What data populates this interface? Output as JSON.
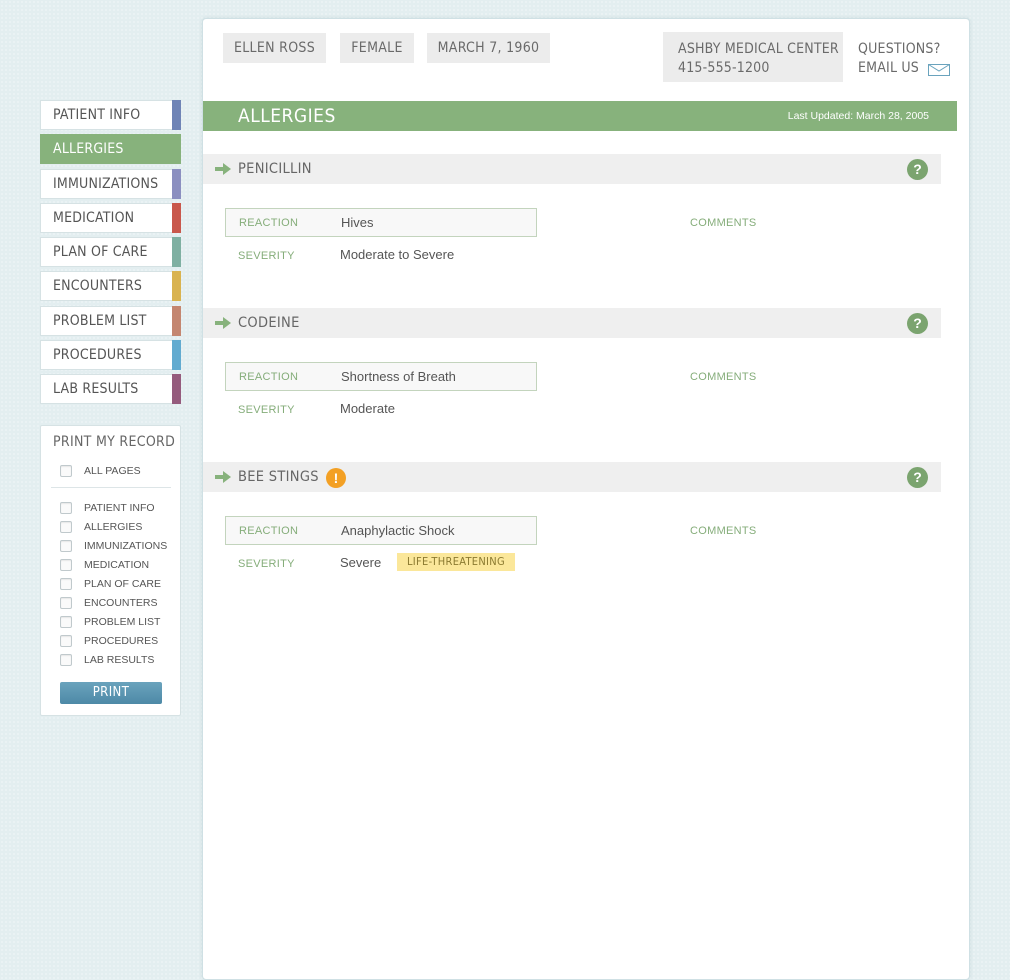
{
  "patient": {
    "name": "ELLEN ROSS",
    "gender": "FEMALE",
    "dob": "MARCH 7, 1960"
  },
  "facility": {
    "name": "ASHBY MEDICAL CENTER",
    "phone": "415-555-1200"
  },
  "contact": {
    "questions": "QUESTIONS?",
    "email_label": "EMAIL US",
    "email_icon": "envelope-icon"
  },
  "nav": {
    "items": [
      {
        "label": "PATIENT INFO",
        "color": "#6f84b6",
        "active": false
      },
      {
        "label": "ALLERGIES",
        "color": "#87b27c",
        "active": true
      },
      {
        "label": "IMMUNIZATIONS",
        "color": "#8b8fc0",
        "active": false
      },
      {
        "label": "MEDICATION",
        "color": "#c9584c",
        "active": false
      },
      {
        "label": "PLAN OF CARE",
        "color": "#7fb0a2",
        "active": false
      },
      {
        "label": "ENCOUNTERS",
        "color": "#d9b350",
        "active": false
      },
      {
        "label": "PROBLEM LIST",
        "color": "#c48670",
        "active": false
      },
      {
        "label": "PROCEDURES",
        "color": "#62abd0",
        "active": false
      },
      {
        "label": "LAB RESULTS",
        "color": "#955b7d",
        "active": false
      }
    ]
  },
  "print": {
    "title": "PRINT MY RECORD",
    "all_pages": "ALL PAGES",
    "options": [
      "PATIENT INFO",
      "ALLERGIES",
      "IMMUNIZATIONS",
      "MEDICATION",
      "PLAN OF CARE",
      "ENCOUNTERS",
      "PROBLEM LIST",
      "PROCEDURES",
      "LAB RESULTS"
    ],
    "button": "PRINT"
  },
  "section": {
    "title": "ALLERGIES",
    "last_updated": "Last Updated: March 28, 2005",
    "accent_color": "#87b27c"
  },
  "labels": {
    "reaction": "REACTION",
    "severity": "SEVERITY",
    "comments": "COMMENTS"
  },
  "allergies": [
    {
      "name": "PENICILLIN",
      "reaction": "Hives",
      "severity": "Moderate to Severe",
      "warning": false,
      "badge": ""
    },
    {
      "name": "CODEINE",
      "reaction": "Shortness of Breath",
      "severity": "Moderate",
      "warning": false,
      "badge": ""
    },
    {
      "name": "BEE STINGS",
      "reaction": "Anaphylactic Shock",
      "severity": "Severe",
      "warning": true,
      "badge": "LIFE-THREATENING"
    }
  ]
}
